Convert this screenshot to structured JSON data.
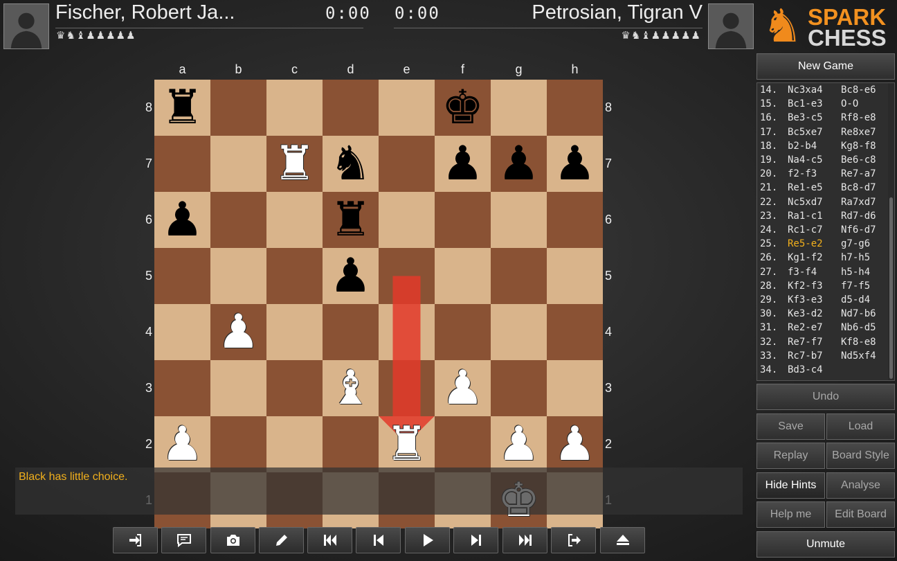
{
  "players": {
    "white": {
      "name": "Fischer, Robert Ja...",
      "clock": "0:00",
      "captured": "♛♞♝♟♟♟♟♟"
    },
    "black": {
      "name": "Petrosian, Tigran V",
      "clock": "0:00",
      "captured": "♛♞♝♟♟♟♟♟"
    }
  },
  "logo": {
    "line1": "SPARK",
    "line2": "CHESS"
  },
  "board": {
    "files": [
      "a",
      "b",
      "c",
      "d",
      "e",
      "f",
      "g",
      "h"
    ],
    "ranks": [
      "8",
      "7",
      "6",
      "5",
      "4",
      "3",
      "2",
      "1"
    ],
    "light_color": "#d9b48b",
    "dark_color": "#8a5234",
    "pieces": [
      {
        "square": "a8",
        "color": "black",
        "type": "rook",
        "glyph": "♜"
      },
      {
        "square": "f8",
        "color": "black",
        "type": "king",
        "glyph": "♚"
      },
      {
        "square": "c7",
        "color": "white",
        "type": "rook",
        "glyph": "♜"
      },
      {
        "square": "d7",
        "color": "black",
        "type": "knight",
        "glyph": "♞"
      },
      {
        "square": "f7",
        "color": "black",
        "type": "pawn",
        "glyph": "♟"
      },
      {
        "square": "g7",
        "color": "black",
        "type": "pawn",
        "glyph": "♟"
      },
      {
        "square": "h7",
        "color": "black",
        "type": "pawn",
        "glyph": "♟"
      },
      {
        "square": "a6",
        "color": "black",
        "type": "pawn",
        "glyph": "♟"
      },
      {
        "square": "d6",
        "color": "black",
        "type": "rook",
        "glyph": "♜"
      },
      {
        "square": "d5",
        "color": "black",
        "type": "pawn",
        "glyph": "♟"
      },
      {
        "square": "b4",
        "color": "white",
        "type": "pawn",
        "glyph": "♟"
      },
      {
        "square": "d3",
        "color": "white",
        "type": "bishop",
        "glyph": "♝"
      },
      {
        "square": "f3",
        "color": "white",
        "type": "pawn",
        "glyph": "♟"
      },
      {
        "square": "a2",
        "color": "white",
        "type": "pawn",
        "glyph": "♟"
      },
      {
        "square": "e2",
        "color": "white",
        "type": "rook",
        "glyph": "♜"
      },
      {
        "square": "g2",
        "color": "white",
        "type": "pawn",
        "glyph": "♟"
      },
      {
        "square": "h2",
        "color": "white",
        "type": "pawn",
        "glyph": "♟"
      },
      {
        "square": "g1",
        "color": "white",
        "type": "king",
        "glyph": "♚"
      }
    ],
    "hint_arrow": {
      "from": "e5",
      "to": "e2",
      "color": "#e23a2a"
    }
  },
  "hint": {
    "text": "Black has little choice."
  },
  "toolbar": [
    {
      "name": "login-button",
      "icon": "login-icon"
    },
    {
      "name": "chat-button",
      "icon": "chat-icon"
    },
    {
      "name": "screenshot-button",
      "icon": "camera-icon"
    },
    {
      "name": "edit-button",
      "icon": "pencil-icon"
    },
    {
      "name": "first-move-button",
      "icon": "skip-start-icon"
    },
    {
      "name": "prev-move-button",
      "icon": "step-back-icon"
    },
    {
      "name": "play-button",
      "icon": "play-icon"
    },
    {
      "name": "next-move-button",
      "icon": "step-forward-icon"
    },
    {
      "name": "last-move-button",
      "icon": "skip-end-icon"
    },
    {
      "name": "exit-button",
      "icon": "logout-icon"
    },
    {
      "name": "eject-button",
      "icon": "eject-icon"
    }
  ],
  "panel": {
    "new_game": "New Game",
    "undo": "Undo",
    "save": "Save",
    "load": "Load",
    "replay": "Replay",
    "board_style": "Board Style",
    "hide_hints": "Hide Hints",
    "analyse": "Analyse",
    "help_me": "Help me",
    "edit_board": "Edit Board",
    "unmute": "Unmute"
  },
  "moves": [
    {
      "num": "14.",
      "white": "Nc3xa4",
      "black": "Bc8-e6"
    },
    {
      "num": "15.",
      "white": "Bc1-e3",
      "black": "O-O"
    },
    {
      "num": "16.",
      "white": "Be3-c5",
      "black": "Rf8-e8"
    },
    {
      "num": "17.",
      "white": "Bc5xe7",
      "black": "Re8xe7"
    },
    {
      "num": "18.",
      "white": "b2-b4",
      "black": "Kg8-f8"
    },
    {
      "num": "19.",
      "white": "Na4-c5",
      "black": "Be6-c8"
    },
    {
      "num": "20.",
      "white": "f2-f3",
      "black": "Re7-a7"
    },
    {
      "num": "21.",
      "white": "Re1-e5",
      "black": "Bc8-d7"
    },
    {
      "num": "22.",
      "white": "Nc5xd7",
      "black": "Ra7xd7"
    },
    {
      "num": "23.",
      "white": "Ra1-c1",
      "black": "Rd7-d6"
    },
    {
      "num": "24.",
      "white": "Rc1-c7",
      "black": "Nf6-d7"
    },
    {
      "num": "25.",
      "white": "Re5-e2",
      "black": "g7-g6",
      "highlight": "white"
    },
    {
      "num": "26.",
      "white": "Kg1-f2",
      "black": "h7-h5"
    },
    {
      "num": "27.",
      "white": "f3-f4",
      "black": "h5-h4"
    },
    {
      "num": "28.",
      "white": "Kf2-f3",
      "black": "f7-f5"
    },
    {
      "num": "29.",
      "white": "Kf3-e3",
      "black": "d5-d4"
    },
    {
      "num": "30.",
      "white": "Ke3-d2",
      "black": "Nd7-b6"
    },
    {
      "num": "31.",
      "white": "Re2-e7",
      "black": "Nb6-d5"
    },
    {
      "num": "32.",
      "white": "Re7-f7",
      "black": "Kf8-e8"
    },
    {
      "num": "33.",
      "white": "Rc7-b7",
      "black": "Nd5xf4"
    },
    {
      "num": "34.",
      "white": "Bd3-c4",
      "black": ""
    }
  ],
  "colors": {
    "accent": "#f2b01c",
    "arrow": "#e23a2a",
    "logo_orange": "#f29120"
  }
}
